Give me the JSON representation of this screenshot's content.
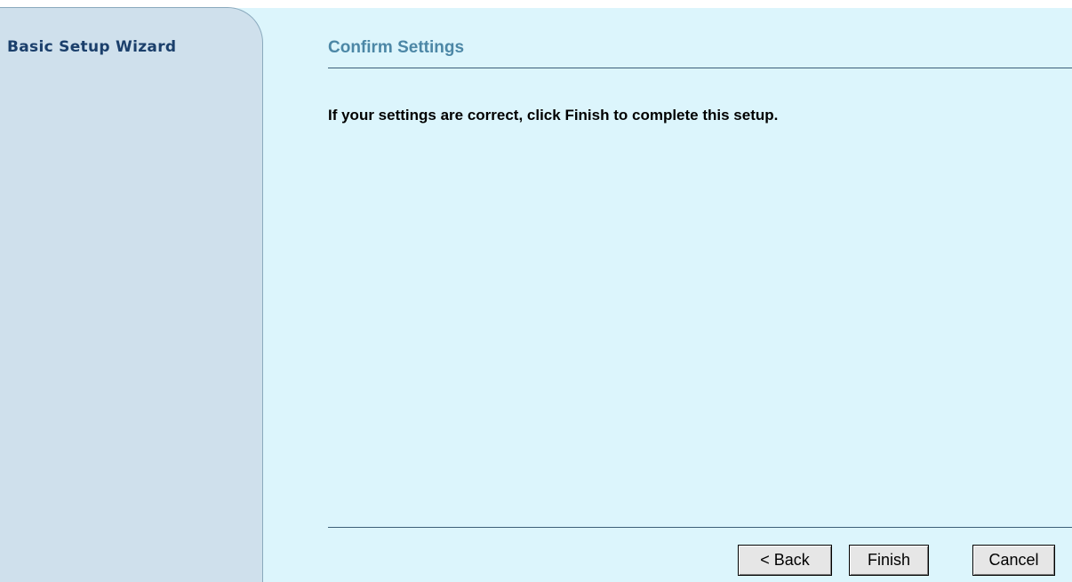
{
  "sidebar": {
    "title": "Basic Setup Wizard"
  },
  "main": {
    "section_title": "Confirm Settings",
    "instructions": "If your settings are correct, click Finish to complete this setup."
  },
  "buttons": {
    "back_label": "< Back",
    "finish_label": "Finish",
    "cancel_label": "Cancel"
  },
  "colors": {
    "content_background": "#dcf5fc",
    "sidebar_background": "#cfe0ec",
    "sidebar_title": "#1b3f6b",
    "section_title": "#4c87a6"
  }
}
